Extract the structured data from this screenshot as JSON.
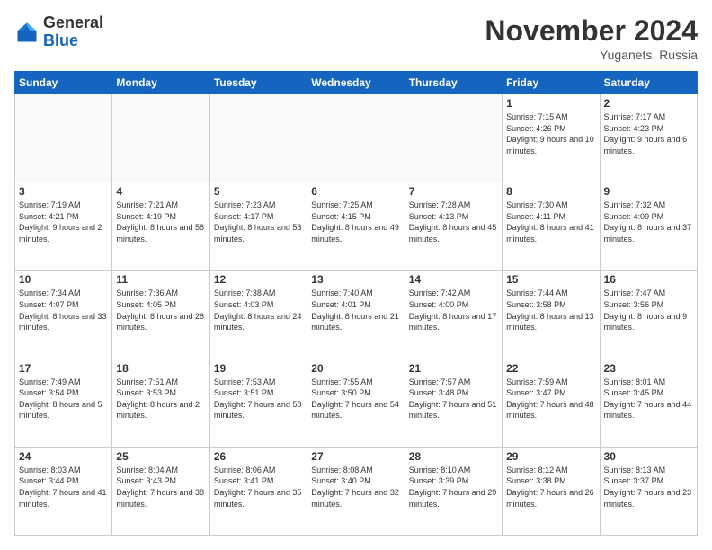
{
  "logo": {
    "general": "General",
    "blue": "Blue"
  },
  "header": {
    "month": "November 2024",
    "location": "Yuganets, Russia"
  },
  "days_of_week": [
    "Sunday",
    "Monday",
    "Tuesday",
    "Wednesday",
    "Thursday",
    "Friday",
    "Saturday"
  ],
  "weeks": [
    [
      {
        "day": "",
        "info": ""
      },
      {
        "day": "",
        "info": ""
      },
      {
        "day": "",
        "info": ""
      },
      {
        "day": "",
        "info": ""
      },
      {
        "day": "",
        "info": ""
      },
      {
        "day": "1",
        "info": "Sunrise: 7:15 AM\nSunset: 4:26 PM\nDaylight: 9 hours and 10 minutes."
      },
      {
        "day": "2",
        "info": "Sunrise: 7:17 AM\nSunset: 4:23 PM\nDaylight: 9 hours and 6 minutes."
      }
    ],
    [
      {
        "day": "3",
        "info": "Sunrise: 7:19 AM\nSunset: 4:21 PM\nDaylight: 9 hours and 2 minutes."
      },
      {
        "day": "4",
        "info": "Sunrise: 7:21 AM\nSunset: 4:19 PM\nDaylight: 8 hours and 58 minutes."
      },
      {
        "day": "5",
        "info": "Sunrise: 7:23 AM\nSunset: 4:17 PM\nDaylight: 8 hours and 53 minutes."
      },
      {
        "day": "6",
        "info": "Sunrise: 7:25 AM\nSunset: 4:15 PM\nDaylight: 8 hours and 49 minutes."
      },
      {
        "day": "7",
        "info": "Sunrise: 7:28 AM\nSunset: 4:13 PM\nDaylight: 8 hours and 45 minutes."
      },
      {
        "day": "8",
        "info": "Sunrise: 7:30 AM\nSunset: 4:11 PM\nDaylight: 8 hours and 41 minutes."
      },
      {
        "day": "9",
        "info": "Sunrise: 7:32 AM\nSunset: 4:09 PM\nDaylight: 8 hours and 37 minutes."
      }
    ],
    [
      {
        "day": "10",
        "info": "Sunrise: 7:34 AM\nSunset: 4:07 PM\nDaylight: 8 hours and 33 minutes."
      },
      {
        "day": "11",
        "info": "Sunrise: 7:36 AM\nSunset: 4:05 PM\nDaylight: 8 hours and 28 minutes."
      },
      {
        "day": "12",
        "info": "Sunrise: 7:38 AM\nSunset: 4:03 PM\nDaylight: 8 hours and 24 minutes."
      },
      {
        "day": "13",
        "info": "Sunrise: 7:40 AM\nSunset: 4:01 PM\nDaylight: 8 hours and 21 minutes."
      },
      {
        "day": "14",
        "info": "Sunrise: 7:42 AM\nSunset: 4:00 PM\nDaylight: 8 hours and 17 minutes."
      },
      {
        "day": "15",
        "info": "Sunrise: 7:44 AM\nSunset: 3:58 PM\nDaylight: 8 hours and 13 minutes."
      },
      {
        "day": "16",
        "info": "Sunrise: 7:47 AM\nSunset: 3:56 PM\nDaylight: 8 hours and 9 minutes."
      }
    ],
    [
      {
        "day": "17",
        "info": "Sunrise: 7:49 AM\nSunset: 3:54 PM\nDaylight: 8 hours and 5 minutes."
      },
      {
        "day": "18",
        "info": "Sunrise: 7:51 AM\nSunset: 3:53 PM\nDaylight: 8 hours and 2 minutes."
      },
      {
        "day": "19",
        "info": "Sunrise: 7:53 AM\nSunset: 3:51 PM\nDaylight: 7 hours and 58 minutes."
      },
      {
        "day": "20",
        "info": "Sunrise: 7:55 AM\nSunset: 3:50 PM\nDaylight: 7 hours and 54 minutes."
      },
      {
        "day": "21",
        "info": "Sunrise: 7:57 AM\nSunset: 3:48 PM\nDaylight: 7 hours and 51 minutes."
      },
      {
        "day": "22",
        "info": "Sunrise: 7:59 AM\nSunset: 3:47 PM\nDaylight: 7 hours and 48 minutes."
      },
      {
        "day": "23",
        "info": "Sunrise: 8:01 AM\nSunset: 3:45 PM\nDaylight: 7 hours and 44 minutes."
      }
    ],
    [
      {
        "day": "24",
        "info": "Sunrise: 8:03 AM\nSunset: 3:44 PM\nDaylight: 7 hours and 41 minutes."
      },
      {
        "day": "25",
        "info": "Sunrise: 8:04 AM\nSunset: 3:43 PM\nDaylight: 7 hours and 38 minutes."
      },
      {
        "day": "26",
        "info": "Sunrise: 8:06 AM\nSunset: 3:41 PM\nDaylight: 7 hours and 35 minutes."
      },
      {
        "day": "27",
        "info": "Sunrise: 8:08 AM\nSunset: 3:40 PM\nDaylight: 7 hours and 32 minutes."
      },
      {
        "day": "28",
        "info": "Sunrise: 8:10 AM\nSunset: 3:39 PM\nDaylight: 7 hours and 29 minutes."
      },
      {
        "day": "29",
        "info": "Sunrise: 8:12 AM\nSunset: 3:38 PM\nDaylight: 7 hours and 26 minutes."
      },
      {
        "day": "30",
        "info": "Sunrise: 8:13 AM\nSunset: 3:37 PM\nDaylight: 7 hours and 23 minutes."
      }
    ]
  ]
}
